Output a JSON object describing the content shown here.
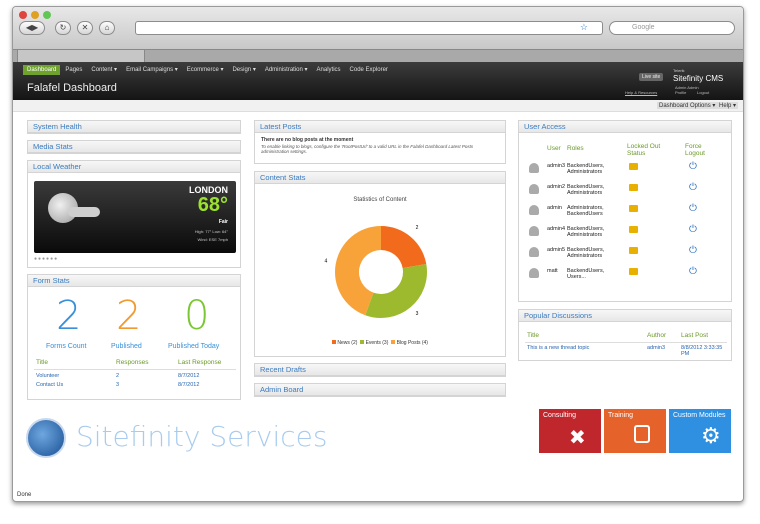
{
  "browser": {
    "search_placeholder": "Google",
    "status": "Done",
    "new_tab": "+"
  },
  "nav": {
    "items": [
      "Dashboard",
      "Pages",
      "Content ▾",
      "Email Campaigns ▾",
      "Ecommerce ▾",
      "Design ▾",
      "Administration ▾",
      "Analytics",
      "Code Explorer"
    ],
    "live_site": "Live site",
    "brand_small": "Telerik",
    "brand": "Sitefinity CMS",
    "user": "Admin Admin",
    "profile": "Profile",
    "logout": "Logout",
    "help_resources": "Help & Resources"
  },
  "page": {
    "title": "Falafel Dashboard",
    "options": "Dashboard Options ▾",
    "help": "Help ▾"
  },
  "left": {
    "system_health": "System Health",
    "media_stats": "Media Stats",
    "local_weather": "Local Weather",
    "city": "LONDON",
    "temp": "68°",
    "cond": "Fair",
    "hilo": "High: 77°  Low: 64°",
    "wind": "Wind: ESE 7mph",
    "form_stats": "Form Stats",
    "stats": [
      {
        "n": "2",
        "l": "Forms Count"
      },
      {
        "n": "2",
        "l": "Published"
      },
      {
        "n": "0",
        "l": "Published Today"
      }
    ],
    "table_headers": [
      "Title",
      "Responses",
      "Last Response"
    ],
    "rows": [
      [
        "Volunteer",
        "2",
        "8/7/2012"
      ],
      [
        "Contact Us",
        "3",
        "8/7/2012"
      ]
    ]
  },
  "mid": {
    "latest_posts": "Latest Posts",
    "no_posts": "There are no blog posts at the moment",
    "no_posts_hint": "To enable linking to blogs, configure the 'RootPostUrl' to a valid URL in the Falafel Dashboard Latest Posts administration settings.",
    "content_stats": "Content Stats",
    "recent_drafts": "Recent Drafts",
    "admin_board": "Admin Board"
  },
  "chart_data": {
    "type": "pie",
    "title": "Statistics of Content",
    "categories": [
      "News",
      "Events",
      "Blog Posts"
    ],
    "values": [
      2,
      3,
      4
    ],
    "colors": [
      "#f26b1d",
      "#9dba2e",
      "#f7a33a"
    ],
    "legend": [
      "News (2)",
      "Events (3)",
      "Blog Posts (4)"
    ],
    "legend_position": "bottom"
  },
  "right": {
    "user_access": "User Access",
    "headers": [
      "User",
      "Roles",
      "Locked Out Status",
      "Force Logout"
    ],
    "users": [
      [
        "admin3",
        "BackendUsers, Administrators"
      ],
      [
        "admin2",
        "BackendUsers, Administrators"
      ],
      [
        "admin",
        "Administrators, BackendUsers"
      ],
      [
        "admin4",
        "BackendUsers, Administrators"
      ],
      [
        "admin5",
        "BackendUsers, Administrators"
      ],
      [
        "matt",
        "BackendUsers, Users..."
      ]
    ],
    "popular": "Popular Discussions",
    "pheaders": [
      "Title",
      "Author",
      "Last Post"
    ],
    "prow": [
      "This is a new thread topic",
      "admin3",
      "8/8/2012 3:33:35 PM"
    ]
  },
  "footer": {
    "services": "Sitefinity Services",
    "tiles": [
      "Consulting",
      "Training",
      "Custom Modules"
    ],
    "colors": [
      "#c0272d",
      "#e5632b",
      "#2f8fe0"
    ]
  }
}
